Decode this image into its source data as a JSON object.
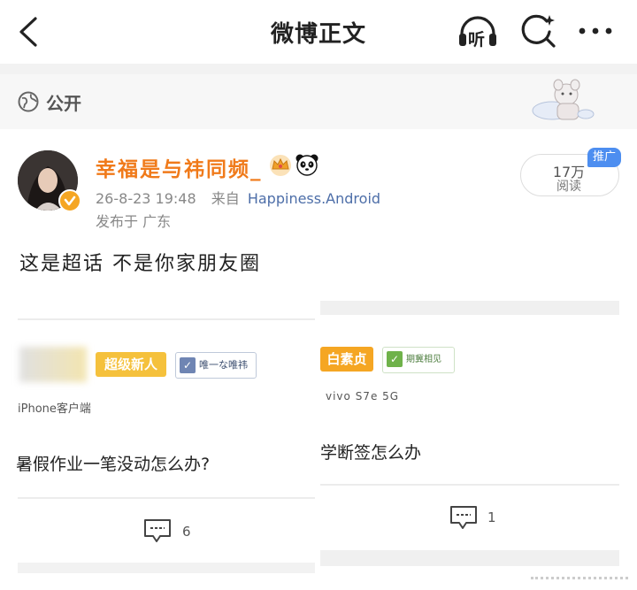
{
  "nav": {
    "title": "微博正文",
    "listen_label": "听"
  },
  "visibility": {
    "label": "公开"
  },
  "post": {
    "author": "幸福是与祎同频_",
    "time": "26-8-23 19:48",
    "source_prefix": "来自",
    "source": "Happiness.Android",
    "location": "发布于 广东",
    "read_count": "17万",
    "read_label": "阅读",
    "promo_badge": "推广",
    "text": "这是超话 不是你家朋友圈"
  },
  "images": [
    {
      "tag_primary": "超级新人",
      "tag_secondary": "唯一な唯祎",
      "client": "iPhone客户端",
      "question": "暑假作业一笔没动怎么办?",
      "comment_count": "6"
    },
    {
      "tag_primary": "白素贞",
      "tag_secondary": "期冀相见",
      "client": "vivo S7e 5G",
      "question": "学断签怎么办",
      "comment_count": "1"
    }
  ],
  "colors": {
    "username": "#f07a1a",
    "source_link": "#4d6ea8",
    "promo": "#4d8ef0",
    "verified": "#f5a623"
  }
}
